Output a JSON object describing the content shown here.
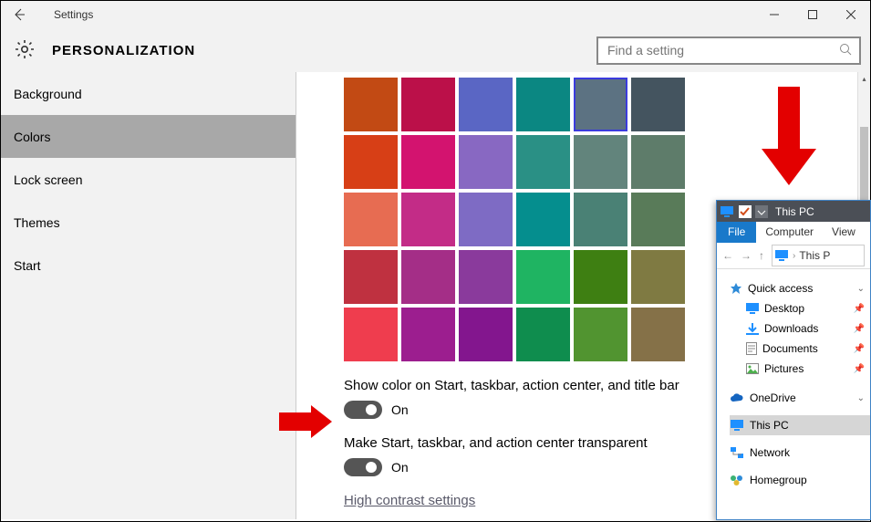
{
  "window": {
    "title": "Settings"
  },
  "heading": "PERSONALIZATION",
  "search": {
    "placeholder": "Find a setting"
  },
  "sidebar": {
    "items": [
      {
        "label": "Background"
      },
      {
        "label": "Colors"
      },
      {
        "label": "Lock screen"
      },
      {
        "label": "Themes"
      },
      {
        "label": "Start"
      }
    ],
    "selected": 1
  },
  "colors": {
    "rows": [
      [
        "#c24a14",
        "#bb1049",
        "#5a66c4",
        "#0b8782",
        "#5c7282",
        "#44545f"
      ],
      [
        "#d73f16",
        "#d3136f",
        "#8868c2",
        "#2a9085",
        "#62847c",
        "#5e7c6a"
      ],
      [
        "#e76c52",
        "#c32c87",
        "#7e6bc4",
        "#058e8e",
        "#4a8175",
        "#597b59"
      ],
      [
        "#bf3140",
        "#a42e87",
        "#8a3a9c",
        "#1fb462",
        "#3e7f12",
        "#7f7a42"
      ],
      [
        "#ef3d4e",
        "#9c1e8f",
        "#83168e",
        "#0f8d4e",
        "#519430",
        "#857148"
      ]
    ],
    "selected": {
      "row": 0,
      "col": 4
    },
    "toggle1_label": "Show color on Start, taskbar, action center, and title bar",
    "toggle1_value": "On",
    "toggle2_label": "Make Start, taskbar, and action center transparent",
    "toggle2_value": "On",
    "link": "High contrast settings"
  },
  "explorer": {
    "title": "This PC",
    "file_tab": "File",
    "tabs": [
      "Computer",
      "View"
    ],
    "address": "This P",
    "quick_access": "Quick access",
    "qa_items": [
      {
        "label": "Desktop",
        "icon": "desktop"
      },
      {
        "label": "Downloads",
        "icon": "downloads"
      },
      {
        "label": "Documents",
        "icon": "documents"
      },
      {
        "label": "Pictures",
        "icon": "pictures"
      }
    ],
    "onedrive": "OneDrive",
    "this_pc": "This PC",
    "network": "Network",
    "homegroup": "Homegroup"
  }
}
